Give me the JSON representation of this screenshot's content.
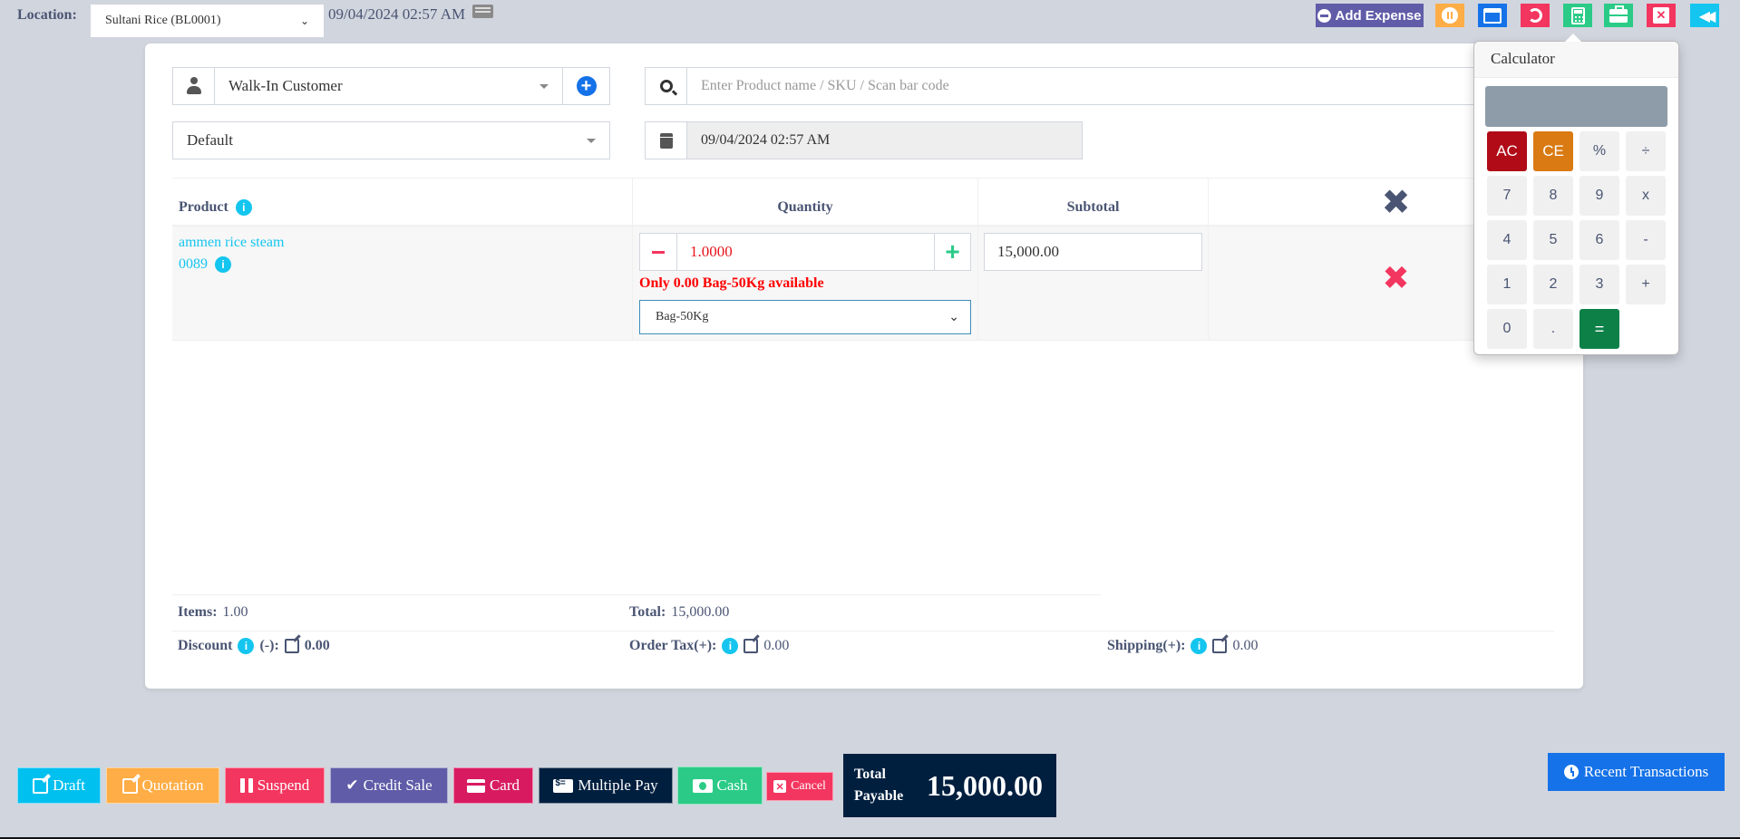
{
  "topbar": {
    "location_label": "Location:",
    "location_value": "Sultani Rice (BL0001)",
    "datetime": "09/04/2024 02:57 AM",
    "add_expense_label": "Add Expense",
    "icons": [
      "pause-circle-icon",
      "window-icon",
      "undo-icon",
      "calculator-icon",
      "briefcase-icon",
      "close-window-icon",
      "backward-icon"
    ]
  },
  "form": {
    "customer_value": "Walk-In Customer",
    "price_group_value": "Default",
    "search_placeholder": "Enter Product name / SKU / Scan bar code",
    "transaction_date": "09/04/2024 02:57 AM"
  },
  "table": {
    "headers": {
      "product": "Product",
      "quantity": "Quantity",
      "subtotal": "Subtotal"
    },
    "rows": [
      {
        "product_name": "ammen rice steam",
        "sku": "0089",
        "quantity": "1.0000",
        "stock_warning": "Only 0.00 Bag-50Kg available",
        "unit": "Bag-50Kg",
        "subtotal": "15,000.00"
      }
    ]
  },
  "totals": {
    "items_label": "Items:",
    "items_value": "1.00",
    "total_label": "Total:",
    "total_value": "15,000.00",
    "discount_label": "Discount",
    "discount_suffix": "(-):",
    "discount_value": "0.00",
    "tax_label": "Order Tax(+):",
    "tax_value": "0.00",
    "shipping_label": "Shipping(+):",
    "shipping_value": "0.00"
  },
  "calculator": {
    "title": "Calculator",
    "display": "",
    "keys": [
      "AC",
      "CE",
      "%",
      "÷",
      "7",
      "8",
      "9",
      "x",
      "4",
      "5",
      "6",
      "-",
      "1",
      "2",
      "3",
      "+",
      "0",
      ".",
      "="
    ]
  },
  "actions": {
    "draft": "Draft",
    "quotation": "Quotation",
    "suspend": "Suspend",
    "credit_sale": "Credit Sale",
    "card": "Card",
    "multiple_pay": "Multiple Pay",
    "cash": "Cash",
    "cancel": "Cancel",
    "total_payable_label_1": "Total",
    "total_payable_label_2": "Payable",
    "total_payable_value": "15,000.00",
    "recent_transactions": "Recent Transactions"
  }
}
